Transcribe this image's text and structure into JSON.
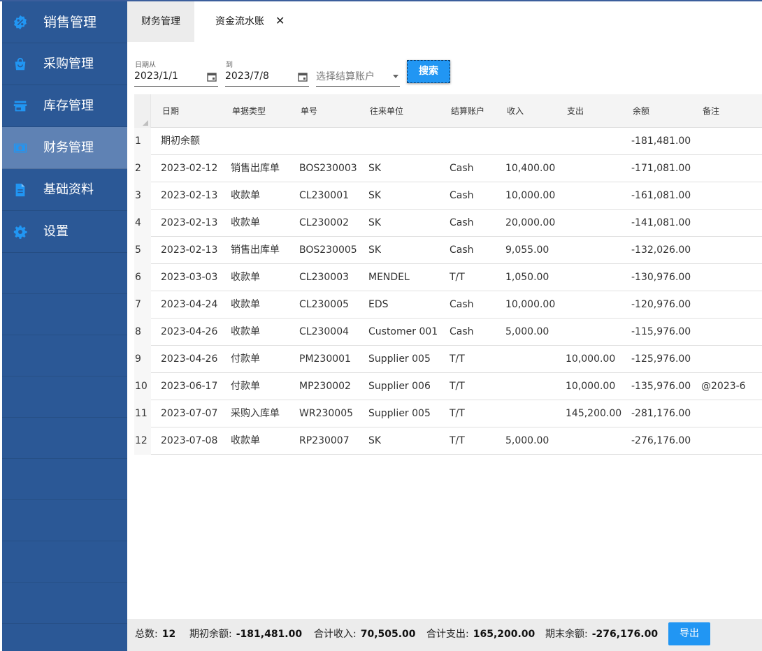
{
  "sidebar": {
    "items": [
      {
        "label": "销售管理",
        "icon": "percent-badge-icon"
      },
      {
        "label": "采购管理",
        "icon": "shopping-bag-icon"
      },
      {
        "label": "库存管理",
        "icon": "store-icon"
      },
      {
        "label": "财务管理",
        "icon": "money-icon",
        "active": true
      },
      {
        "label": "基础资料",
        "icon": "document-icon"
      },
      {
        "label": "设置",
        "icon": "gear-icon"
      }
    ]
  },
  "tabs": {
    "finance": "财务管理",
    "cashflow": "资金流水账",
    "close": "✕"
  },
  "filters": {
    "date_from_label": "日期从",
    "date_from": "2023/1/1",
    "date_to_label": "到",
    "date_to": "2023/7/8",
    "account_placeholder": "选择结算账户",
    "search_label": "搜索"
  },
  "table": {
    "columns": [
      "日期",
      "单据类型",
      "单号",
      "往来单位",
      "结算账户",
      "收入",
      "支出",
      "余额",
      "备注"
    ],
    "rows": [
      {
        "idx": "1",
        "date": "期初余额",
        "type": "",
        "no": "",
        "party": "",
        "account": "",
        "income": "",
        "expense": "",
        "balance": "-181,481.00",
        "note": ""
      },
      {
        "idx": "2",
        "date": "2023-02-12",
        "type": "销售出库单",
        "no": "BOS230003",
        "party": "SK",
        "account": "Cash",
        "income": "10,400.00",
        "expense": "",
        "balance": "-171,081.00",
        "note": ""
      },
      {
        "idx": "3",
        "date": "2023-02-13",
        "type": "收款单",
        "no": "CL230001",
        "party": "SK",
        "account": "Cash",
        "income": "10,000.00",
        "expense": "",
        "balance": "-161,081.00",
        "note": ""
      },
      {
        "idx": "4",
        "date": "2023-02-13",
        "type": "收款单",
        "no": "CL230002",
        "party": "SK",
        "account": "Cash",
        "income": "20,000.00",
        "expense": "",
        "balance": "-141,081.00",
        "note": ""
      },
      {
        "idx": "5",
        "date": "2023-02-13",
        "type": "销售出库单",
        "no": "BOS230005",
        "party": "SK",
        "account": "Cash",
        "income": "9,055.00",
        "expense": "",
        "balance": "-132,026.00",
        "note": ""
      },
      {
        "idx": "6",
        "date": "2023-03-03",
        "type": "收款单",
        "no": "CL230003",
        "party": "MENDEL",
        "account": "T/T",
        "income": "1,050.00",
        "expense": "",
        "balance": "-130,976.00",
        "note": ""
      },
      {
        "idx": "7",
        "date": "2023-04-24",
        "type": "收款单",
        "no": "CL230005",
        "party": "EDS",
        "account": "Cash",
        "income": "10,000.00",
        "expense": "",
        "balance": "-120,976.00",
        "note": ""
      },
      {
        "idx": "8",
        "date": "2023-04-26",
        "type": "收款单",
        "no": "CL230004",
        "party": "Customer 001",
        "account": "Cash",
        "income": "5,000.00",
        "expense": "",
        "balance": "-115,976.00",
        "note": ""
      },
      {
        "idx": "9",
        "date": "2023-04-26",
        "type": "付款单",
        "no": "PM230001",
        "party": "Supplier 005",
        "account": "T/T",
        "income": "",
        "expense": "10,000.00",
        "balance": "-125,976.00",
        "note": ""
      },
      {
        "idx": "10",
        "date": "2023-06-17",
        "type": "付款单",
        "no": "MP230002",
        "party": "Supplier 006",
        "account": "T/T",
        "income": "",
        "expense": "10,000.00",
        "balance": "-135,976.00",
        "note": "@2023-6"
      },
      {
        "idx": "11",
        "date": "2023-07-07",
        "type": "采购入库单",
        "no": "WR230005",
        "party": "Supplier 005",
        "account": "T/T",
        "income": "",
        "expense": "145,200.00",
        "balance": "-281,176.00",
        "note": ""
      },
      {
        "idx": "12",
        "date": "2023-07-08",
        "type": "收款单",
        "no": "RP230007",
        "party": "SK",
        "account": "T/T",
        "income": "5,000.00",
        "expense": "",
        "balance": "-276,176.00",
        "note": ""
      }
    ]
  },
  "footer": {
    "count_label": "总数:",
    "count": "12",
    "opening_label": "期初余额:",
    "opening": "-181,481.00",
    "income_label": "合计收入:",
    "income": "70,505.00",
    "expense_label": "合计支出:",
    "expense": "165,200.00",
    "closing_label": "期末余额:",
    "closing": "-276,176.00",
    "export_label": "导出"
  },
  "colors": {
    "sidebar_bg": "#2b5896",
    "sidebar_active": "#5f82b4",
    "icon_blue": "#2196f3",
    "button_blue": "#2196f3"
  }
}
